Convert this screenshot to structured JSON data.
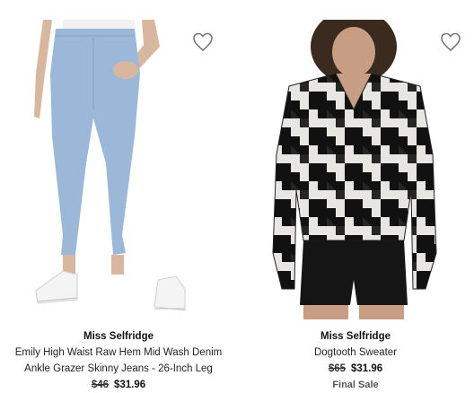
{
  "products": [
    {
      "brand": "Miss Selfridge",
      "name_line1": "Emily High Waist Raw Hem Mid Wash Denim",
      "name_line2": "Ankle Grazer Skinny Jeans - 26-Inch Leg",
      "price_original": "$46",
      "price_sale": "$31.96",
      "image_icon": "jeans-model-image",
      "wishlist_icon": "heart-icon"
    },
    {
      "brand": "Miss Selfridge",
      "name_line1": "Dogtooth Sweater",
      "price_original": "$65",
      "price_sale": "$31.96",
      "note": "Final Sale",
      "image_icon": "sweater-model-image",
      "wishlist_icon": "heart-icon"
    }
  ],
  "colors": {
    "denim": "#9bb8d9",
    "sweater_dark": "#111111",
    "sweater_light": "#e8e6e2",
    "skin": "#c9a083"
  }
}
